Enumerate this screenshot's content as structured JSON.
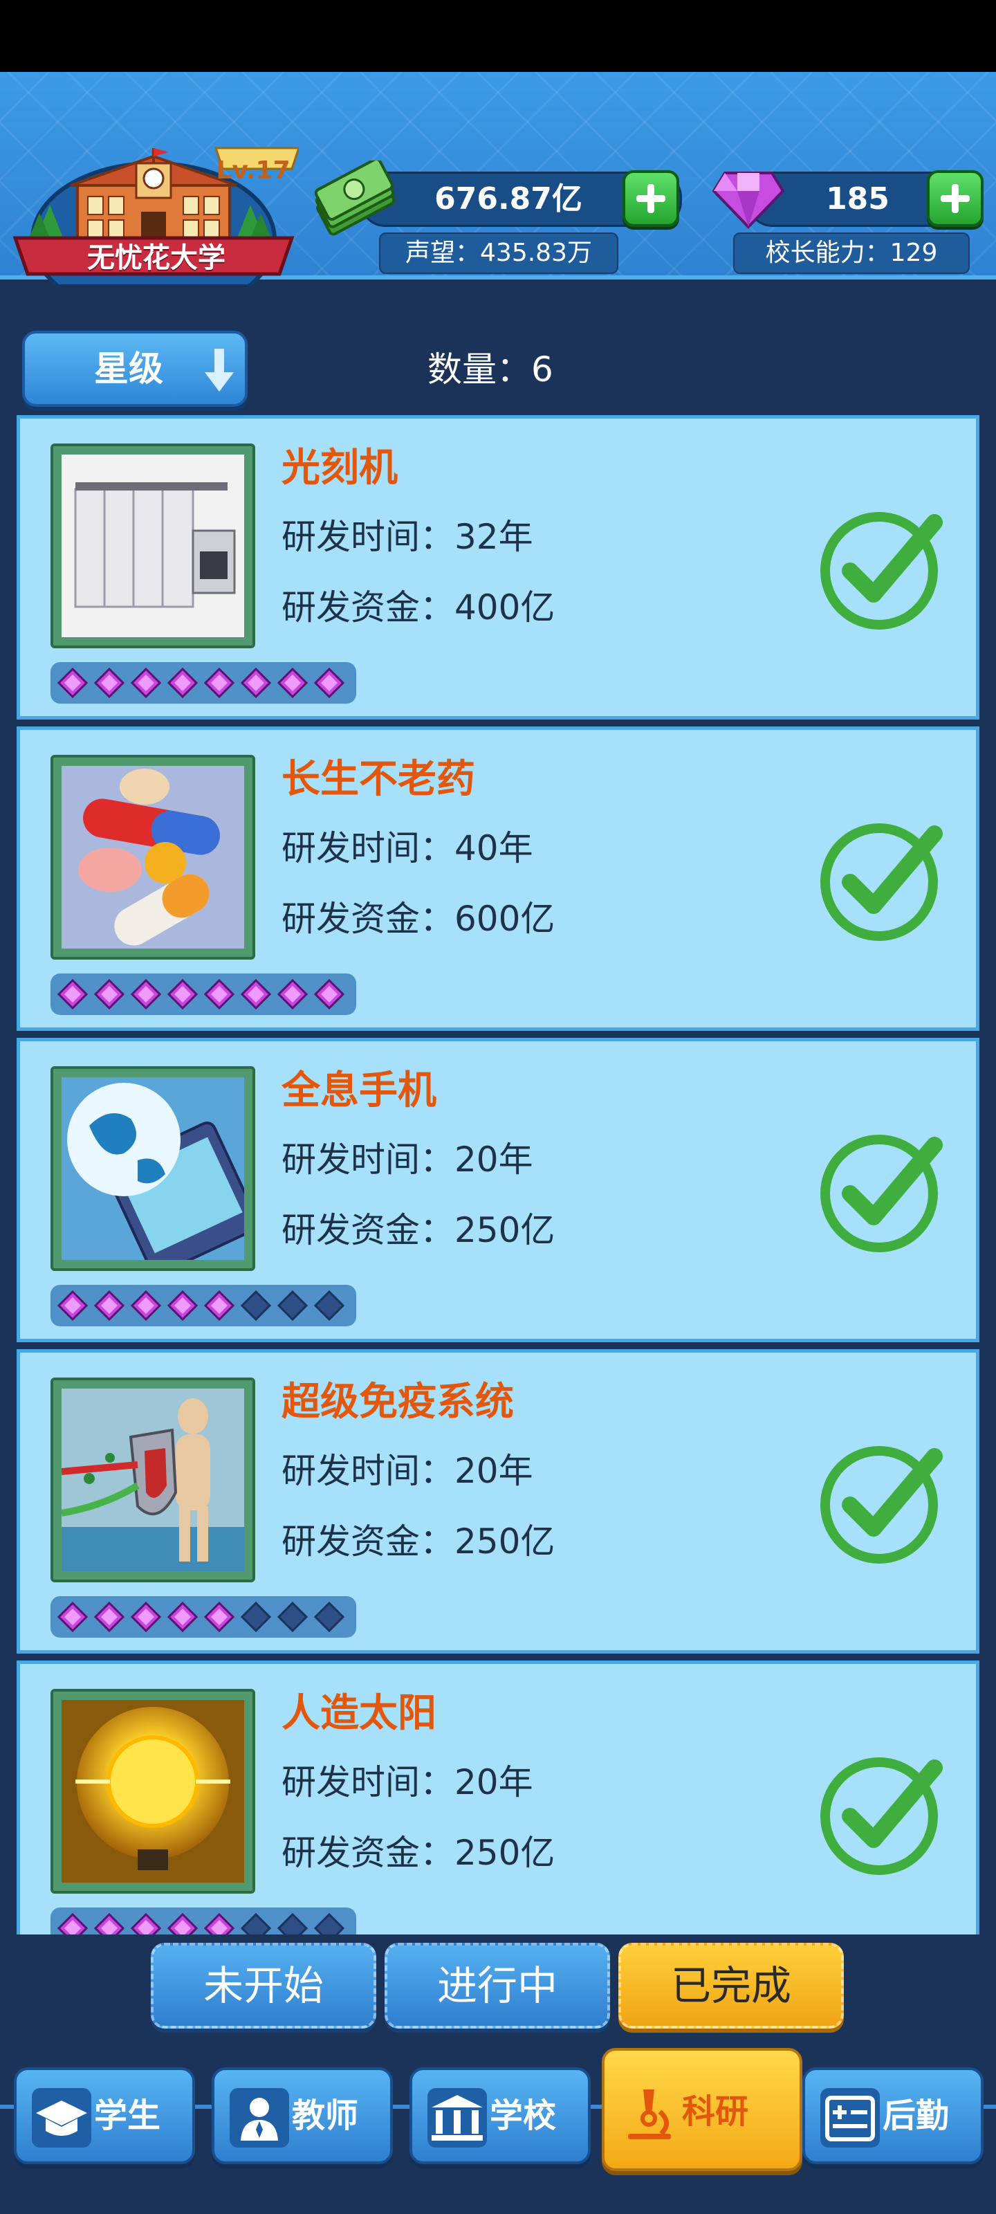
{
  "header": {
    "school_name": "无忧花大学",
    "level": "Lv.17",
    "money": "676.87亿",
    "gems": "185",
    "reputation": "声望：435.83万",
    "principal_ability": "校长能力：129"
  },
  "filter": {
    "sort_label": "星级",
    "count": "数量：6"
  },
  "research_items": [
    {
      "title": "光刻机",
      "time": "研发时间：32年",
      "funds": "研发资金：400亿",
      "stars": 8,
      "max_stars": 8,
      "icon": "lithography-machine-icon"
    },
    {
      "title": "长生不老药",
      "time": "研发时间：40年",
      "funds": "研发资金：600亿",
      "stars": 8,
      "max_stars": 8,
      "icon": "pills-icon"
    },
    {
      "title": "全息手机",
      "time": "研发时间：20年",
      "funds": "研发资金：250亿",
      "stars": 5,
      "max_stars": 8,
      "icon": "holographic-phone-icon"
    },
    {
      "title": "超级免疫系统",
      "time": "研发时间：20年",
      "funds": "研发资金：250亿",
      "stars": 5,
      "max_stars": 8,
      "icon": "immune-shield-icon"
    },
    {
      "title": "人造太阳",
      "time": "研发时间：20年",
      "funds": "研发资金：250亿",
      "stars": 5,
      "max_stars": 8,
      "icon": "artificial-sun-icon"
    }
  ],
  "status_tabs": [
    {
      "label": "未开始",
      "active": false
    },
    {
      "label": "进行中",
      "active": false
    },
    {
      "label": "已完成",
      "active": true
    }
  ],
  "nav": [
    {
      "label": "学生",
      "icon": "graduation-cap-icon",
      "active": false
    },
    {
      "label": "教师",
      "icon": "teacher-icon",
      "active": false
    },
    {
      "label": "学校",
      "icon": "school-building-icon",
      "active": false
    },
    {
      "label": "科研",
      "icon": "microscope-icon",
      "active": true
    },
    {
      "label": "后勤",
      "icon": "logistics-icon",
      "active": false
    }
  ],
  "colors": {
    "accent_orange": "#e3570d",
    "card_bg": "#a7e0fb",
    "check_green": "#3fae3f",
    "active_gold": "#f4a915"
  }
}
